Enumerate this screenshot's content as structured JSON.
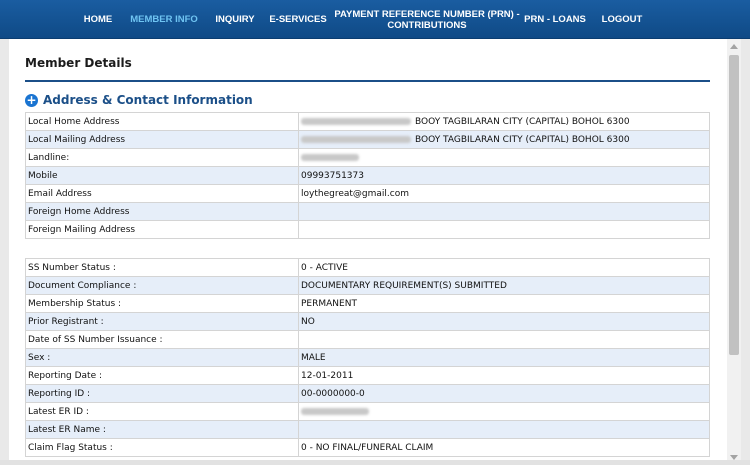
{
  "nav": {
    "home": "HOME",
    "member_info": "MEMBER INFO",
    "inquiry": "INQUIRY",
    "eservices": "E-SERVICES",
    "prn_contrib_line1": "PAYMENT REFERENCE NUMBER (PRN) -",
    "prn_contrib_line2": "CONTRIBUTIONS",
    "prn_loans": "PRN - LOANS",
    "logout": "LOGOUT"
  },
  "colors": {
    "navbar": "#1a5da1",
    "active_nav": "#6fc4f2",
    "section_title": "#1b4f88",
    "row_alt": "#e6eef9"
  },
  "page": {
    "title": "Member Details",
    "section_title": "Address & Contact Information"
  },
  "address_table": [
    {
      "label": "Local Home Address",
      "value": "BOOY TAGBILARAN CITY (CAPITAL) BOHOL 6300"
    },
    {
      "label": "Local Mailing Address",
      "value": "BOOY TAGBILARAN CITY (CAPITAL) BOHOL 6300"
    },
    {
      "label": "Landline:",
      "value": ""
    },
    {
      "label": "Mobile",
      "value": "09993751373"
    },
    {
      "label": "Email Address",
      "value": "loythegreat@gmail.com"
    },
    {
      "label": "Foreign Home Address",
      "value": ""
    },
    {
      "label": "Foreign Mailing Address",
      "value": ""
    }
  ],
  "status_table": [
    {
      "label": "SS Number Status :",
      "value": "0 - ACTIVE"
    },
    {
      "label": "Document Compliance :",
      "value": "DOCUMENTARY REQUIREMENT(S) SUBMITTED"
    },
    {
      "label": "Membership Status :",
      "value": "PERMANENT"
    },
    {
      "label": "Prior Registrant :",
      "value": "NO"
    },
    {
      "label": "Date of SS Number Issuance :",
      "value": ""
    },
    {
      "label": "Sex :",
      "value": "MALE"
    },
    {
      "label": "Reporting Date :",
      "value": "12-01-2011"
    },
    {
      "label": "Reporting ID :",
      "value": "00-0000000-0"
    },
    {
      "label": "Latest ER ID :",
      "value": ""
    },
    {
      "label": "Latest ER Name :",
      "value": ""
    },
    {
      "label": "Claim Flag Status :",
      "value": "0 - NO FINAL/FUNERAL CLAIM"
    }
  ]
}
